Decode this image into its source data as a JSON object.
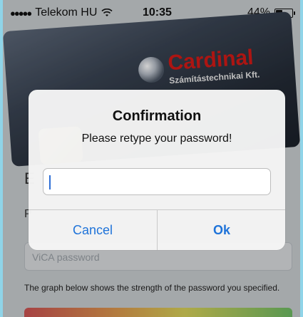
{
  "status_bar": {
    "signal": "●●●●●",
    "carrier": "Telekom HU",
    "time": "10:35",
    "battery": "44%",
    "battery_level": 0.44
  },
  "background": {
    "card": {
      "brand": "Cardinal",
      "subtitle": "Számítástechnikai Kft."
    },
    "heading_partial": "E",
    "label_partial": "P",
    "password_placeholder": "ViCA password",
    "description": "The graph below shows the strength of the password you specified."
  },
  "dialog": {
    "title": "Confirmation",
    "message": "Please retype your password!",
    "input_value": "",
    "cancel_label": "Cancel",
    "ok_label": "Ok"
  },
  "colors": {
    "accent": "#1e73d9",
    "card_brand": "#d31a17",
    "frame": "#8fd4e8"
  }
}
